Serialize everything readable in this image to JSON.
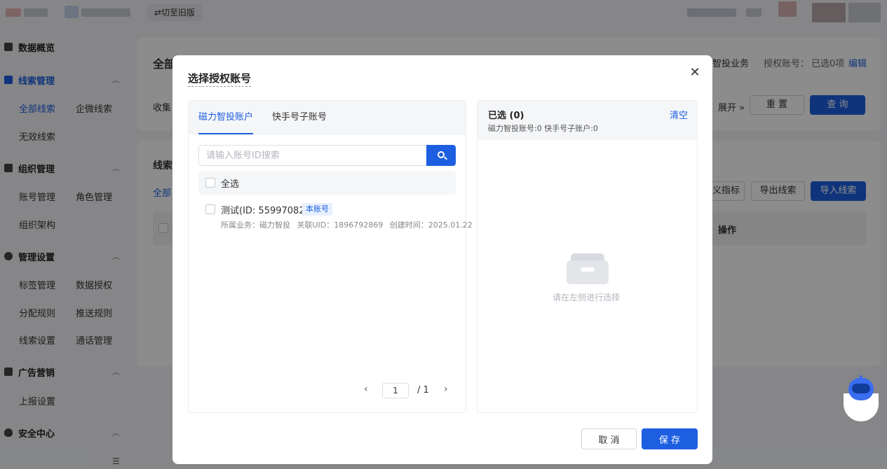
{
  "topbar": {
    "switch_old_label": "⇄切至旧版"
  },
  "sidebar": {
    "groups": [
      {
        "label": "数据概览",
        "icon": "chart-icon"
      },
      {
        "label": "线索管理",
        "icon": "leads-icon",
        "items": [
          "全部线索",
          "企微线索",
          "无效线索"
        ]
      },
      {
        "label": "组织管理",
        "icon": "people-icon",
        "items": [
          "账号管理",
          "角色管理",
          "组织架构"
        ]
      },
      {
        "label": "管理设置",
        "icon": "settings-icon",
        "items": [
          "标签管理",
          "数据授权",
          "分配规则",
          "推送规则",
          "线索设置",
          "通话管理"
        ]
      },
      {
        "label": "广告营销",
        "icon": "ad-icon",
        "items": [
          "上报设置"
        ]
      },
      {
        "label": "安全中心",
        "icon": "shield-icon"
      }
    ],
    "collapse_icon": "menu-collapse-icon"
  },
  "background": {
    "header_title": "全部",
    "biz_label": "智投业务",
    "auth_account_label": "授权账号：",
    "auth_account_value": "已选0项",
    "edit_link": "编辑",
    "collect_label": "收集",
    "expand_label": "展开 »",
    "reset_button": "重 置",
    "query_button": "查 询",
    "list_title": "线索",
    "all_tab": "全部",
    "metric_button": "义指标",
    "export_button": "导出线索",
    "import_button": "导入线索",
    "col_action": "操作"
  },
  "modal": {
    "title": "选择授权账号",
    "close_icon": "close-icon",
    "tabs": [
      "磁力智投账户",
      "快手号子账号"
    ],
    "search": {
      "placeholder": "请输入账号ID搜索",
      "icon": "search-icon"
    },
    "select_all_label": "全选",
    "accounts": [
      {
        "name": "测试(ID: 55997082)",
        "tag": "本账号",
        "business": "所属业务：磁力智投",
        "uid": "关联UID：1896792869",
        "created": "创建时间：2025.01.22"
      }
    ],
    "pagination": {
      "current": "1",
      "total": "/ 1"
    },
    "selected": {
      "title": "已选 (0)",
      "clear_label": "清空",
      "counts": "磁力智投账号:0   快手号子账户:0",
      "empty_text": "请在左侧进行选择",
      "empty_icon": "empty-inbox-icon"
    },
    "cancel_label": "取 消",
    "save_label": "保 存"
  },
  "colors": {
    "primary": "#1d5fe0",
    "overlay": "rgba(0,0,0,0.45)"
  }
}
